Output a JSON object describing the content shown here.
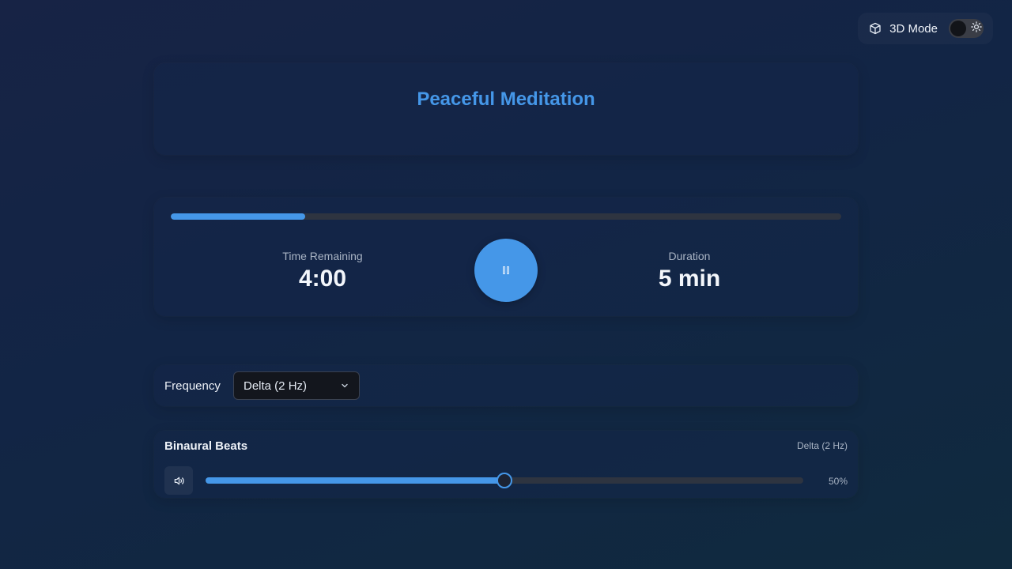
{
  "topbar": {
    "mode_label": "3D Mode",
    "mode_enabled": false,
    "icons": [
      "cube-icon",
      "sun-icon"
    ]
  },
  "title": "Peaceful Meditation",
  "timer": {
    "progress_fraction": 0.2,
    "time_remaining_label": "Time Remaining",
    "time_remaining_value": "4:00",
    "duration_label": "Duration",
    "duration_value": "5 min",
    "play_state": "playing",
    "play_icon": "pause-icon"
  },
  "frequency": {
    "label": "Frequency",
    "selected": "Delta (2 Hz)"
  },
  "binaural": {
    "title": "Binaural Beats",
    "frequency_label": "Delta (2 Hz)",
    "volume_fraction": 0.5,
    "volume_text": "50%",
    "volume_icon": "volume-icon"
  },
  "colors": {
    "accent": "#4597e8",
    "track": "#2e3440",
    "background": "#152544"
  }
}
